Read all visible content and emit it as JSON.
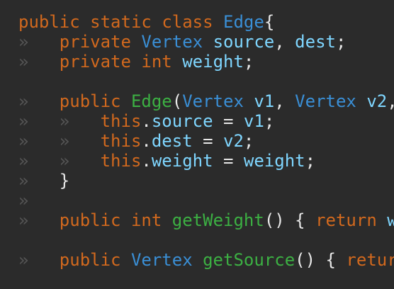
{
  "editor": {
    "lines": [
      {
        "indent": 0,
        "tokens": [
          {
            "t": "public",
            "c": "kw"
          },
          {
            "t": " ",
            "c": "ws"
          },
          {
            "t": "static",
            "c": "kw"
          },
          {
            "t": " ",
            "c": "ws"
          },
          {
            "t": "class",
            "c": "kw"
          },
          {
            "t": " ",
            "c": "ws"
          },
          {
            "t": "Edge",
            "c": "type"
          },
          {
            "t": "{",
            "c": "punc"
          }
        ]
      },
      {
        "indent": 1,
        "tokens": [
          {
            "t": "private",
            "c": "kw"
          },
          {
            "t": " ",
            "c": "ws"
          },
          {
            "t": "Vertex",
            "c": "type"
          },
          {
            "t": " ",
            "c": "ws"
          },
          {
            "t": "source",
            "c": "var"
          },
          {
            "t": ",",
            "c": "punc"
          },
          {
            "t": " ",
            "c": "ws"
          },
          {
            "t": "dest",
            "c": "var"
          },
          {
            "t": ";",
            "c": "punc"
          }
        ]
      },
      {
        "indent": 1,
        "tokens": [
          {
            "t": "private",
            "c": "kw"
          },
          {
            "t": " ",
            "c": "ws"
          },
          {
            "t": "int",
            "c": "kw"
          },
          {
            "t": " ",
            "c": "ws"
          },
          {
            "t": "weight",
            "c": "var"
          },
          {
            "t": ";",
            "c": "punc"
          }
        ]
      },
      {
        "indent": 0,
        "tokens": []
      },
      {
        "indent": 1,
        "tokens": [
          {
            "t": "public",
            "c": "kw"
          },
          {
            "t": " ",
            "c": "ws"
          },
          {
            "t": "Edge",
            "c": "fn"
          },
          {
            "t": "(",
            "c": "punc"
          },
          {
            "t": "Vertex",
            "c": "type"
          },
          {
            "t": " ",
            "c": "ws"
          },
          {
            "t": "v1",
            "c": "var"
          },
          {
            "t": ",",
            "c": "punc"
          },
          {
            "t": " ",
            "c": "ws"
          },
          {
            "t": "Vertex",
            "c": "type"
          },
          {
            "t": " ",
            "c": "ws"
          },
          {
            "t": "v2",
            "c": "var"
          },
          {
            "t": ",",
            "c": "punc"
          }
        ]
      },
      {
        "indent": 2,
        "tokens": [
          {
            "t": "this",
            "c": "kw"
          },
          {
            "t": ".",
            "c": "punc"
          },
          {
            "t": "source",
            "c": "var"
          },
          {
            "t": " ",
            "c": "ws"
          },
          {
            "t": "=",
            "c": "op"
          },
          {
            "t": " ",
            "c": "ws"
          },
          {
            "t": "v1",
            "c": "var"
          },
          {
            "t": ";",
            "c": "punc"
          }
        ]
      },
      {
        "indent": 2,
        "tokens": [
          {
            "t": "this",
            "c": "kw"
          },
          {
            "t": ".",
            "c": "punc"
          },
          {
            "t": "dest",
            "c": "var"
          },
          {
            "t": " ",
            "c": "ws"
          },
          {
            "t": "=",
            "c": "op"
          },
          {
            "t": " ",
            "c": "ws"
          },
          {
            "t": "v2",
            "c": "var"
          },
          {
            "t": ";",
            "c": "punc"
          }
        ]
      },
      {
        "indent": 2,
        "tokens": [
          {
            "t": "this",
            "c": "kw"
          },
          {
            "t": ".",
            "c": "punc"
          },
          {
            "t": "weight",
            "c": "var"
          },
          {
            "t": " ",
            "c": "ws"
          },
          {
            "t": "=",
            "c": "op"
          },
          {
            "t": " ",
            "c": "ws"
          },
          {
            "t": "weight",
            "c": "var"
          },
          {
            "t": ";",
            "c": "punc"
          }
        ]
      },
      {
        "indent": 1,
        "tokens": [
          {
            "t": "}",
            "c": "punc"
          }
        ]
      },
      {
        "indent": 1,
        "tokens": []
      },
      {
        "indent": 1,
        "tokens": [
          {
            "t": "public",
            "c": "kw"
          },
          {
            "t": " ",
            "c": "ws"
          },
          {
            "t": "int",
            "c": "kw"
          },
          {
            "t": " ",
            "c": "ws"
          },
          {
            "t": "getWeight",
            "c": "fn"
          },
          {
            "t": "()",
            "c": "punc"
          },
          {
            "t": " ",
            "c": "ws"
          },
          {
            "t": "{",
            "c": "punc"
          },
          {
            "t": " ",
            "c": "ws"
          },
          {
            "t": "return",
            "c": "kw"
          },
          {
            "t": " ",
            "c": "ws"
          },
          {
            "t": "w",
            "c": "var"
          }
        ]
      },
      {
        "indent": 0,
        "tokens": []
      },
      {
        "indent": 1,
        "tokens": [
          {
            "t": "public",
            "c": "kw"
          },
          {
            "t": " ",
            "c": "ws"
          },
          {
            "t": "Vertex",
            "c": "type"
          },
          {
            "t": " ",
            "c": "ws"
          },
          {
            "t": "getSource",
            "c": "fn"
          },
          {
            "t": "()",
            "c": "punc"
          },
          {
            "t": " ",
            "c": "ws"
          },
          {
            "t": "{",
            "c": "punc"
          },
          {
            "t": " ",
            "c": "ws"
          },
          {
            "t": "retur",
            "c": "kw"
          }
        ]
      }
    ],
    "indent_glyph": "»",
    "space_glyph": "·",
    "colors": {
      "background": "#2b2b2b",
      "keyword": "#d2691e",
      "type": "#3a8fd6",
      "function": "#3cb043",
      "variable": "#7fd6ff",
      "punctuation": "#e8e8e8",
      "whitespace_marker": "#555555"
    }
  }
}
